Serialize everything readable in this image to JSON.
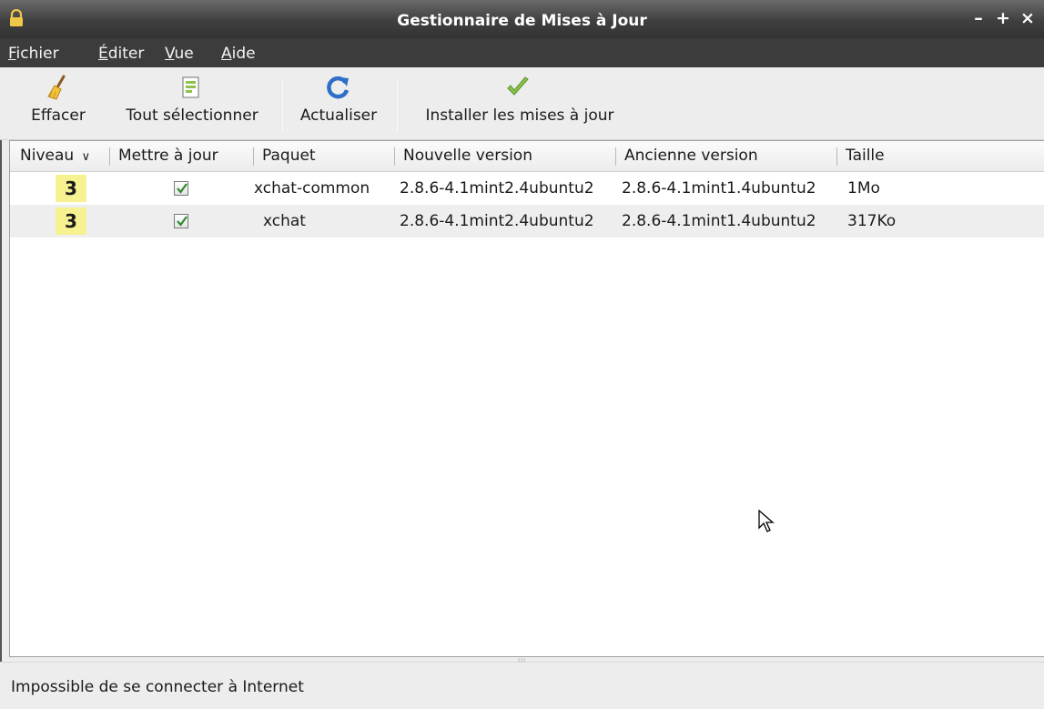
{
  "window": {
    "title": "Gestionnaire de Mises à Jour",
    "controls": {
      "minimize": "–",
      "maximize": "+",
      "close": "×"
    }
  },
  "menubar": {
    "items": [
      {
        "accel": "F",
        "rest": "ichier"
      },
      {
        "accel": "É",
        "rest": "diter"
      },
      {
        "accel": "V",
        "rest": "ue"
      },
      {
        "accel": "A",
        "rest": "ide"
      }
    ]
  },
  "toolbar": {
    "clear_label": "Effacer",
    "select_all_label": "Tout sélectionner",
    "refresh_label": "Actualiser",
    "install_label": "Installer les mises à jour"
  },
  "table": {
    "columns": [
      "Niveau",
      "Mettre à jour",
      "Paquet",
      "Nouvelle version",
      "Ancienne version",
      "Taille"
    ],
    "sort_indicator": "∨",
    "rows": [
      {
        "level": "3",
        "checked": true,
        "package": "xchat-common",
        "new_version": "2.8.6-4.1mint2.4ubuntu2",
        "old_version": "2.8.6-4.1mint1.4ubuntu2",
        "size": "1Mo"
      },
      {
        "level": "3",
        "checked": true,
        "package": "xchat",
        "new_version": "2.8.6-4.1mint2.4ubuntu2",
        "old_version": "2.8.6-4.1mint1.4ubuntu2",
        "size": "317Ko"
      }
    ]
  },
  "statusbar": {
    "text": "Impossible de se connecter à Internet"
  },
  "colors": {
    "level_badge": "#f7f291",
    "titlebar": "#3f3f3f",
    "menubar": "#3c3c3c",
    "checkmark": "#2e8b2e"
  }
}
